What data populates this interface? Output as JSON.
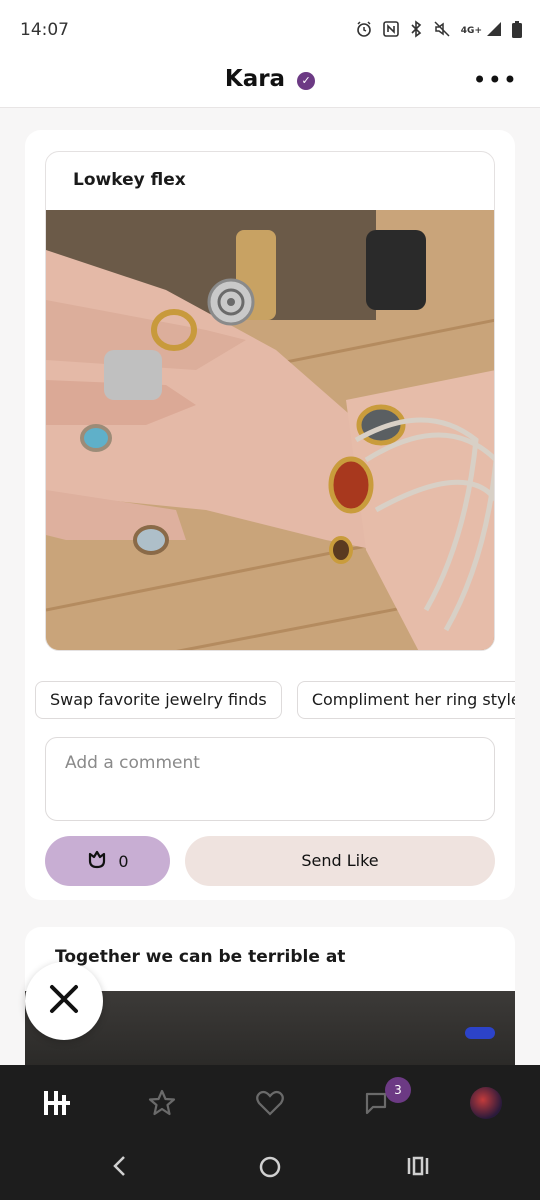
{
  "status_bar": {
    "time": "14:07",
    "network": "4G+",
    "icons": [
      "alarm-icon",
      "nfc-icon",
      "bluetooth-icon",
      "mute-icon",
      "signal-icon",
      "battery-icon"
    ]
  },
  "header": {
    "title": "Kara",
    "verified_icon": "verified-badge-icon",
    "more_icon": "more-icon"
  },
  "post": {
    "prompt": "Lowkey flex",
    "photo_icon": "jewelry-photo"
  },
  "chips": [
    "Swap favorite jewelry finds",
    "Compliment her ring style"
  ],
  "comment": {
    "placeholder": "Add a comment"
  },
  "rose": {
    "count": "0",
    "icon": "rose-icon"
  },
  "send_like": {
    "label": "Send Like"
  },
  "next_post": {
    "prompt": "Together we can be terrible at"
  },
  "bottom_nav": {
    "items": [
      "home-icon",
      "star-icon",
      "heart-icon",
      "chat-icon",
      "profile-avatar"
    ],
    "chat_badge": "3"
  },
  "system_nav": [
    "back-icon",
    "home-circle-icon",
    "recents-icon"
  ],
  "colors": {
    "accent": "#6c3a84",
    "rose_button": "#c8aed3",
    "like_button": "#efe3df",
    "nav_bg": "#1d1d1d"
  }
}
